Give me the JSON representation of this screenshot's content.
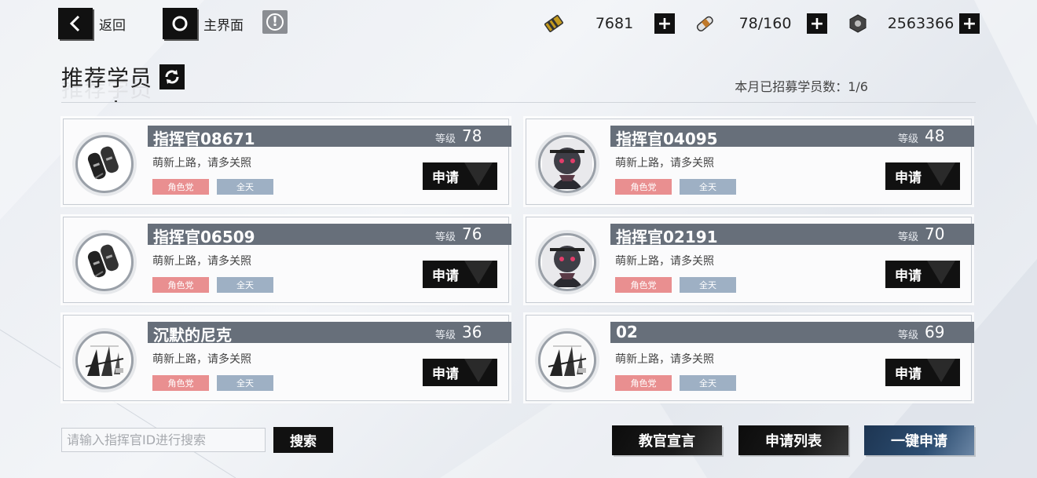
{
  "topbar": {
    "back_label": "返回",
    "home_label": "主界面",
    "info_glyph": "!"
  },
  "resources": [
    {
      "icon": "battery-icon",
      "value": "7681"
    },
    {
      "icon": "stamina-icon",
      "value": "78/160"
    },
    {
      "icon": "bolt-nut-icon",
      "value": "2563366"
    }
  ],
  "section": {
    "title": "推荐学员",
    "recruit_text": "本月已招募学员数：1/6"
  },
  "cards": [
    {
      "name": "指挥官08671",
      "level_label": "等级",
      "level": "78",
      "motto": "萌新上路，请多关照",
      "tag_role": "角色党",
      "tag_time": "全天",
      "apply_label": "申请",
      "avatar": "tags"
    },
    {
      "name": "指挥官04095",
      "level_label": "等级",
      "level": "48",
      "motto": "萌新上路，请多关照",
      "tag_role": "角色党",
      "tag_time": "全天",
      "apply_label": "申请",
      "avatar": "robot"
    },
    {
      "name": "指挥官06509",
      "level_label": "等级",
      "level": "76",
      "motto": "萌新上路，请多关照",
      "tag_role": "角色党",
      "tag_time": "全天",
      "apply_label": "申请",
      "avatar": "tags"
    },
    {
      "name": "指挥官02191",
      "level_label": "等级",
      "level": "70",
      "motto": "萌新上路，请多关照",
      "tag_role": "角色党",
      "tag_time": "全天",
      "apply_label": "申请",
      "avatar": "robot"
    },
    {
      "name": "沉默的尼克",
      "level_label": "等级",
      "level": "36",
      "motto": "萌新上路，请多关照",
      "tag_role": "角色党",
      "tag_time": "全天",
      "apply_label": "申请",
      "avatar": "sketch"
    },
    {
      "name": "02",
      "level_label": "等级",
      "level": "69",
      "motto": "萌新上路，请多关照",
      "tag_role": "角色党",
      "tag_time": "全天",
      "apply_label": "申请",
      "avatar": "sketch"
    }
  ],
  "search": {
    "placeholder": "请输入指挥官ID进行搜索",
    "button_label": "搜索"
  },
  "bottom_buttons": {
    "declaration": "教官宣言",
    "apply_list": "申请列表",
    "one_click": "一键申请"
  },
  "colors": {
    "name_bar": "#676f7a",
    "tag_role": "#e98f90",
    "tag_time": "#9eb0c4",
    "primary_blue": "#1d3552"
  }
}
